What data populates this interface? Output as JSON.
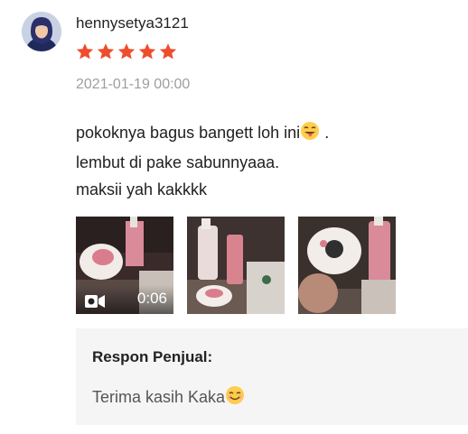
{
  "review": {
    "username": "hennysetya3121",
    "rating": 5,
    "rating_max": 5,
    "star_color": "#ee4d2d",
    "date": "2021-01-19 00:00",
    "comment_lines": [
      "pokoknya bagus bangett loh ini",
      ".",
      "lembut di pake sabunnyaaa.",
      "maksii yah kakkkk"
    ],
    "emoji_icons": [
      "face-with-tongue-emoji",
      "smiling-face-emoji"
    ],
    "media": [
      {
        "type": "video",
        "duration": "0:06",
        "icon": "video-camera-icon"
      },
      {
        "type": "image"
      },
      {
        "type": "image"
      }
    ]
  },
  "seller_response": {
    "title": "Respon Penjual:",
    "text": "Terima kasih Kaka"
  }
}
